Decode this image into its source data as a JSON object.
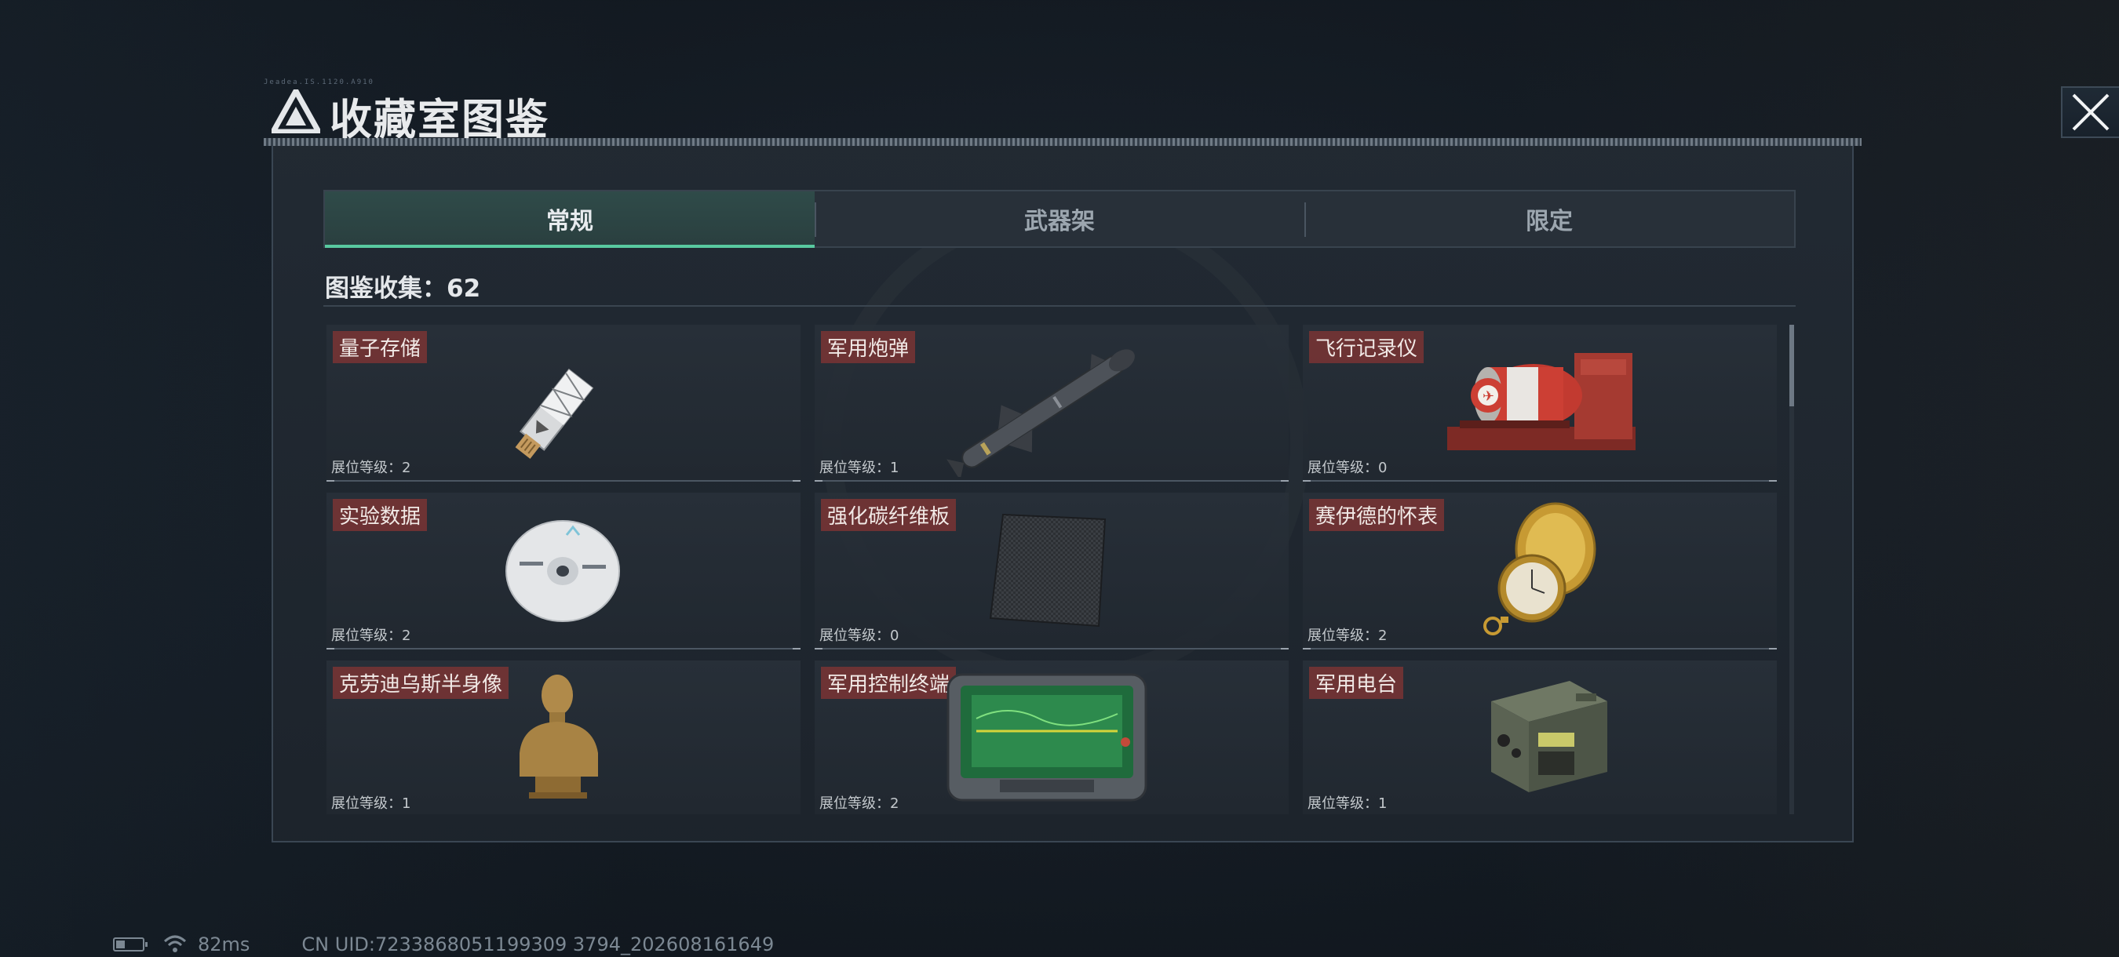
{
  "header": {
    "title": "收藏室图鉴",
    "noise_text": "Jeadea.IS.1120.A910",
    "close_icon": "close-icon"
  },
  "tabs": [
    {
      "label": "常规",
      "active": true
    },
    {
      "label": "武器架",
      "active": false
    },
    {
      "label": "限定",
      "active": false
    }
  ],
  "collection": {
    "label": "图鉴收集：62"
  },
  "items": [
    {
      "name": "量子存储",
      "level": "展位等级：2",
      "icon": "usb-drive-icon"
    },
    {
      "name": "军用炮弹",
      "level": "展位等级：1",
      "icon": "missile-icon"
    },
    {
      "name": "飞行记录仪",
      "level": "展位等级：0",
      "icon": "flight-recorder-icon"
    },
    {
      "name": "实验数据",
      "level": "展位等级：2",
      "icon": "disc-icon"
    },
    {
      "name": "强化碳纤维板",
      "level": "展位等级：0",
      "icon": "carbon-plate-icon"
    },
    {
      "name": "赛伊德的怀表",
      "level": "展位等级：2",
      "icon": "pocket-watch-icon"
    },
    {
      "name": "克劳迪乌斯半身像",
      "level": "展位等级：1",
      "icon": "bust-icon"
    },
    {
      "name": "军用控制终端",
      "level": "展位等级：2",
      "icon": "control-terminal-icon"
    },
    {
      "name": "军用电台",
      "level": "展位等级：1",
      "icon": "radio-icon"
    }
  ],
  "status": {
    "ping": "82ms",
    "uid": "CN UID:7233868051199309 3794_202608161649",
    "battery_level": 0.35
  },
  "colors": {
    "accent": "#58c9a0",
    "name_tag": "#7a3434",
    "panel": "#222a33"
  }
}
